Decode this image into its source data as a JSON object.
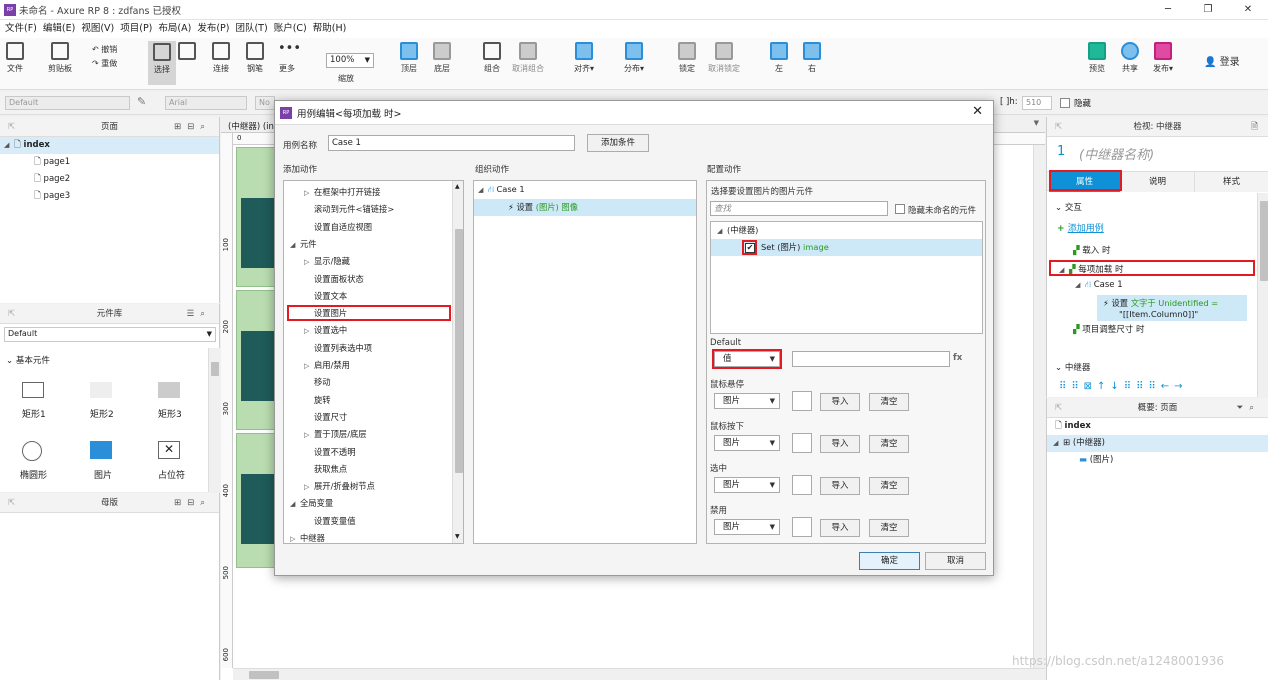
{
  "window": {
    "title": "未命名 - Axure RP 8 : zdfans 已授权",
    "logo": "RP",
    "controls": [
      "─",
      "❐",
      "✕"
    ]
  },
  "menu": [
    "文件(F)",
    "编辑(E)",
    "视图(V)",
    "项目(P)",
    "布局(A)",
    "发布(P)",
    "团队(T)",
    "账户(C)",
    "帮助(H)"
  ],
  "toolbar": {
    "file": "文件",
    "clipboard": "剪贴板",
    "undo": "撤销",
    "redo": "重做",
    "select": "选择",
    "connect": "连接",
    "pen": "钢笔",
    "more": "更多",
    "zoom_value": "100%",
    "zoom_label": "缩放",
    "top": "顶层",
    "bottom": "底层",
    "group": "组合",
    "ungroup": "取消组合",
    "align": "对齐",
    "distribute": "分布",
    "lock": "锁定",
    "unlock": "取消锁定",
    "left": "左",
    "right": "右",
    "preview": "预览",
    "share": "共享",
    "publish": "发布",
    "login": "登录"
  },
  "format_bar": {
    "style": "Default",
    "font": "Arial",
    "font_style": "No",
    "h_label": "h:",
    "h_value": "510",
    "hidden": "隐藏"
  },
  "pages_panel": {
    "title": "页面",
    "items": [
      {
        "label": "index",
        "level": 0
      },
      {
        "label": "page1",
        "level": 1
      },
      {
        "label": "page2",
        "level": 1
      },
      {
        "label": "page3",
        "level": 1
      }
    ]
  },
  "library_panel": {
    "title": "元件库",
    "library": "Default",
    "group": "基本元件",
    "widgets": [
      "矩形1",
      "矩形2",
      "矩形3",
      "椭圆形",
      "图片",
      "占位符"
    ]
  },
  "masters_panel": {
    "title": "母版"
  },
  "canvas": {
    "tab": "(中继器) (ind",
    "ruler_top": [
      "0"
    ],
    "ruler_left": [
      "100",
      "200",
      "300",
      "400",
      "500",
      "600"
    ]
  },
  "dialog": {
    "title": "用例编辑<每项加载 时>",
    "case_name_label": "用例名称",
    "case_name_value": "Case 1",
    "add_condition": "添加条件",
    "add_action_title": "添加动作",
    "organize_title": "组织动作",
    "config_title": "配置动作",
    "actions": [
      {
        "label": "在框架中打开链接",
        "indent": 2,
        "expander": "▷"
      },
      {
        "label": "滚动到元件<锚链接>",
        "indent": 2,
        "expander": ""
      },
      {
        "label": "设置自适应视图",
        "indent": 2,
        "expander": ""
      },
      {
        "label": "元件",
        "indent": 0,
        "expander": "◢"
      },
      {
        "label": "显示/隐藏",
        "indent": 2,
        "expander": "▷"
      },
      {
        "label": "设置面板状态",
        "indent": 2,
        "expander": ""
      },
      {
        "label": "设置文本",
        "indent": 2,
        "expander": ""
      },
      {
        "label": "设置图片",
        "indent": 2,
        "expander": ""
      },
      {
        "label": "设置选中",
        "indent": 2,
        "expander": "▷"
      },
      {
        "label": "设置列表选中项",
        "indent": 2,
        "expander": ""
      },
      {
        "label": "启用/禁用",
        "indent": 2,
        "expander": "▷"
      },
      {
        "label": "移动",
        "indent": 2,
        "expander": ""
      },
      {
        "label": "旋转",
        "indent": 2,
        "expander": ""
      },
      {
        "label": "设置尺寸",
        "indent": 2,
        "expander": ""
      },
      {
        "label": "置于顶层/底层",
        "indent": 2,
        "expander": "▷"
      },
      {
        "label": "设置不透明",
        "indent": 2,
        "expander": ""
      },
      {
        "label": "获取焦点",
        "indent": 2,
        "expander": ""
      },
      {
        "label": "展开/折叠树节点",
        "indent": 2,
        "expander": "▷"
      },
      {
        "label": "全局变量",
        "indent": 0,
        "expander": "◢"
      },
      {
        "label": "设置变量值",
        "indent": 2,
        "expander": ""
      },
      {
        "label": "中继器",
        "indent": 0,
        "expander": "▷"
      }
    ],
    "organize": {
      "case": "Case 1",
      "action_prefix": "设置",
      "action_target": "(图片) 图像"
    },
    "config": {
      "select_label": "选择要设置图片的图片元件",
      "search_placeholder": "查找",
      "hide_unnamed": "隐藏未命名的元件",
      "tree_parent": "(中继器)",
      "tree_child_prefix": "Set (图片)",
      "tree_child_suffix": "image",
      "default_label": "Default",
      "default_select": "值",
      "fx": "fx",
      "states": [
        {
          "label": "鼠标悬停",
          "select": "图片"
        },
        {
          "label": "鼠标按下",
          "select": "图片"
        },
        {
          "label": "选中",
          "select": "图片"
        },
        {
          "label": "禁用",
          "select": "图片"
        }
      ],
      "import": "导入",
      "clear": "清空"
    },
    "ok": "确定",
    "cancel": "取消"
  },
  "inspector": {
    "title": "检视: 中继器",
    "number": "1",
    "name_placeholder": "(中继器名称)",
    "tabs": [
      "属性",
      "说明",
      "样式"
    ],
    "interaction_title": "交互",
    "add_case": "添加用例",
    "events": {
      "load": "载入 时",
      "item_load": "每项加载 时",
      "case": "Case 1",
      "action_prefix": "设置",
      "action_detail": "文字于 Unidentified =",
      "action_value": "\"[[Item.Column0]]\"",
      "resize": "项目调整尺寸 时"
    },
    "repeater_section": "中继器"
  },
  "outline": {
    "title": "概要: 页面",
    "items": [
      {
        "label": "index",
        "level": 0
      },
      {
        "label": "(中继器)",
        "level": 1
      },
      {
        "label": "(图片)",
        "level": 2
      }
    ]
  },
  "watermark": "https://blog.csdn.net/a1248001936",
  "colors": {
    "accent": "#0e91d6",
    "highlight": "#e21b23",
    "selection": "#cde8f7"
  }
}
